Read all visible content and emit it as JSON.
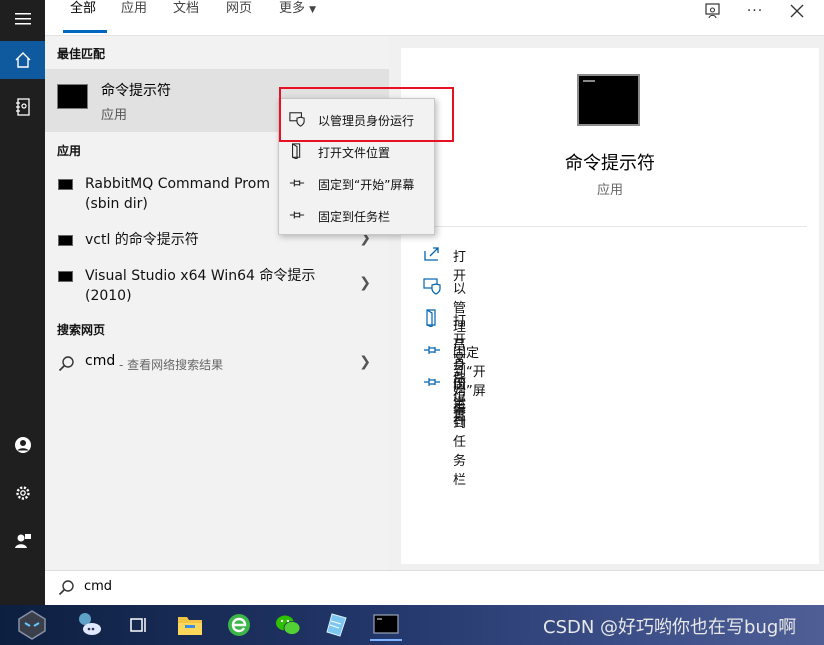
{
  "tabs": {
    "all": "全部",
    "apps": "应用",
    "docs": "文档",
    "web": "网页",
    "more": "更多"
  },
  "left": {
    "best_match_heading": "最佳匹配",
    "best": {
      "title": "命令提示符",
      "subtitle": "应用"
    },
    "apps_heading": "应用",
    "apps": [
      {
        "line1": "RabbitMQ Command Prom",
        "line2": "(sbin dir)"
      },
      {
        "line1": "vctl 的命令提示符",
        "line2": ""
      },
      {
        "line1": "Visual Studio x64 Win64 命令提示",
        "line2": "(2010)"
      }
    ],
    "web_heading": "搜索网页",
    "web": {
      "query": "cmd",
      "hint": "- 查看网络搜索结果"
    }
  },
  "context_menu": [
    {
      "label": "以管理员身份运行",
      "icon": "shield-icon"
    },
    {
      "label": "打开文件位置",
      "icon": "folder-icon"
    },
    {
      "label": "固定到“开始”屏幕",
      "icon": "pin-icon"
    },
    {
      "label": "固定到任务栏",
      "icon": "pin-icon"
    }
  ],
  "detail": {
    "title": "命令提示符",
    "subtitle": "应用",
    "actions": [
      {
        "label": "打开",
        "icon": "open-icon"
      },
      {
        "label": "以管理员身份运行",
        "icon": "shield-icon"
      },
      {
        "label": "打开文件位置",
        "icon": "folder-icon"
      },
      {
        "label": "固定到“开始”屏幕",
        "icon": "pin-icon"
      },
      {
        "label": "固定到任务栏",
        "icon": "pin-icon"
      }
    ]
  },
  "search": {
    "value": "cmd"
  },
  "taskbar": {
    "icons": [
      "app-avatar-icon",
      "cortana-icon",
      "task-view-icon",
      "file-explorer-icon",
      "browser-icon",
      "wechat-icon",
      "notepad-icon",
      "cmd-icon"
    ]
  },
  "watermark": "CSDN @好巧哟你也在写bug啊",
  "colors": {
    "accent": "#0067c0",
    "highlight_box": "#e81123",
    "rail": "#1f1f1f"
  }
}
